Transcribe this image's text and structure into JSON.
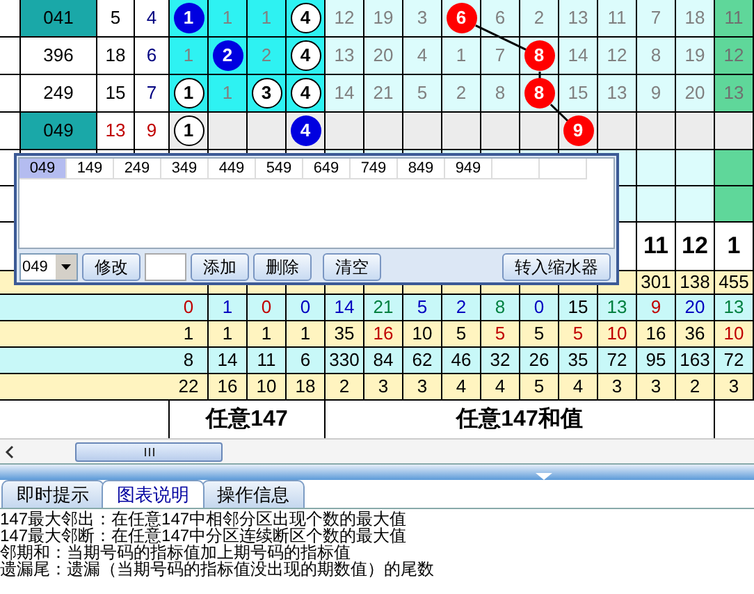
{
  "draw_rows": [
    {
      "number": "041",
      "number_highlight": true,
      "current": false,
      "sum": {
        "text": "5",
        "color": "#000000"
      },
      "span": {
        "text": "4",
        "color": "#000080"
      },
      "balls": [
        {
          "kind": "blue",
          "text": "1"
        },
        {
          "kind": "plain",
          "text": "1"
        },
        {
          "kind": "plain",
          "text": "1"
        },
        {
          "kind": "white",
          "text": "4"
        }
      ],
      "misses": [
        {
          "kind": "plain",
          "text": "12"
        },
        {
          "kind": "plain",
          "text": "19"
        },
        {
          "kind": "plain",
          "text": "3"
        },
        {
          "kind": "ball",
          "text": "6"
        },
        {
          "kind": "plain",
          "text": "6"
        },
        {
          "kind": "plain",
          "text": "2"
        },
        {
          "kind": "plain",
          "text": "13"
        },
        {
          "kind": "plain",
          "text": "11"
        },
        {
          "kind": "plain",
          "text": "7"
        },
        {
          "kind": "plain",
          "text": "18"
        }
      ],
      "tail": "11"
    },
    {
      "number": "396",
      "number_highlight": false,
      "current": false,
      "sum": {
        "text": "18",
        "color": "#000000"
      },
      "span": {
        "text": "6",
        "color": "#000080"
      },
      "balls": [
        {
          "kind": "plain",
          "text": "1"
        },
        {
          "kind": "blue",
          "text": "2"
        },
        {
          "kind": "plain",
          "text": "2"
        },
        {
          "kind": "white",
          "text": "4"
        }
      ],
      "misses": [
        {
          "kind": "plain",
          "text": "13"
        },
        {
          "kind": "plain",
          "text": "20"
        },
        {
          "kind": "plain",
          "text": "4"
        },
        {
          "kind": "plain",
          "text": "1"
        },
        {
          "kind": "plain",
          "text": "7"
        },
        {
          "kind": "ball",
          "text": "8"
        },
        {
          "kind": "plain",
          "text": "14"
        },
        {
          "kind": "plain",
          "text": "12"
        },
        {
          "kind": "plain",
          "text": "8"
        },
        {
          "kind": "plain",
          "text": "19"
        }
      ],
      "tail": "12"
    },
    {
      "number": "249",
      "number_highlight": false,
      "current": false,
      "sum": {
        "text": "15",
        "color": "#000000"
      },
      "span": {
        "text": "7",
        "color": "#000080"
      },
      "balls": [
        {
          "kind": "white",
          "text": "1"
        },
        {
          "kind": "plain",
          "text": "1"
        },
        {
          "kind": "white",
          "text": "3"
        },
        {
          "kind": "white",
          "text": "4"
        }
      ],
      "misses": [
        {
          "kind": "plain",
          "text": "14"
        },
        {
          "kind": "plain",
          "text": "21"
        },
        {
          "kind": "plain",
          "text": "5"
        },
        {
          "kind": "plain",
          "text": "2"
        },
        {
          "kind": "plain",
          "text": "8"
        },
        {
          "kind": "ball",
          "text": "8"
        },
        {
          "kind": "plain",
          "text": "15"
        },
        {
          "kind": "plain",
          "text": "13"
        },
        {
          "kind": "plain",
          "text": "9"
        },
        {
          "kind": "plain",
          "text": "20"
        }
      ],
      "tail": "13"
    },
    {
      "number": "049",
      "number_highlight": true,
      "current": true,
      "sum": {
        "text": "13",
        "color": "#c00000"
      },
      "span": {
        "text": "9",
        "color": "#c00000"
      },
      "balls": [
        {
          "kind": "white",
          "text": "1"
        },
        {
          "kind": "empty"
        },
        {
          "kind": "empty"
        },
        {
          "kind": "blue",
          "text": "4"
        }
      ],
      "misses": [
        {
          "kind": "empty"
        },
        {
          "kind": "empty"
        },
        {
          "kind": "empty"
        },
        {
          "kind": "empty"
        },
        {
          "kind": "empty"
        },
        {
          "kind": "empty"
        },
        {
          "kind": "ball",
          "text": "9"
        },
        {
          "kind": "empty"
        },
        {
          "kind": "empty"
        },
        {
          "kind": "empty"
        }
      ]
    }
  ],
  "column_numbers": [
    "11",
    "12",
    "1"
  ],
  "partial_totals": [
    "301",
    "138",
    "455"
  ],
  "stat_rows": [
    {
      "cells": [
        {
          "text": "0",
          "color": "#c00000"
        },
        {
          "text": "1",
          "color": "#0000c0"
        },
        {
          "text": "0",
          "color": "#c00000"
        },
        {
          "text": "0",
          "color": "#0000c0"
        },
        {
          "text": "14",
          "color": "#0000c0"
        },
        {
          "text": "21",
          "color": "#008040"
        },
        {
          "text": "5",
          "color": "#0000c0"
        },
        {
          "text": "2",
          "color": "#0000c0"
        },
        {
          "text": "8",
          "color": "#008040"
        },
        {
          "text": "0",
          "color": "#0000c0"
        },
        {
          "text": "15",
          "color": "#000000"
        },
        {
          "text": "13",
          "color": "#008040"
        },
        {
          "text": "9",
          "color": "#c00000"
        },
        {
          "text": "20",
          "color": "#0000c0"
        },
        {
          "text": "13",
          "color": "#008040"
        }
      ]
    },
    {
      "cells": [
        {
          "text": "1",
          "color": "#000000"
        },
        {
          "text": "1",
          "color": "#000000"
        },
        {
          "text": "1",
          "color": "#000000"
        },
        {
          "text": "1",
          "color": "#000000"
        },
        {
          "text": "35",
          "color": "#000000"
        },
        {
          "text": "16",
          "color": "#c00000"
        },
        {
          "text": "10",
          "color": "#000000"
        },
        {
          "text": "5",
          "color": "#000000"
        },
        {
          "text": "5",
          "color": "#c00000"
        },
        {
          "text": "5",
          "color": "#000000"
        },
        {
          "text": "5",
          "color": "#c00000"
        },
        {
          "text": "10",
          "color": "#c00000"
        },
        {
          "text": "16",
          "color": "#000000"
        },
        {
          "text": "36",
          "color": "#000000"
        },
        {
          "text": "10",
          "color": "#c00000"
        }
      ]
    },
    {
      "cells": [
        {
          "text": "8",
          "color": "#000000"
        },
        {
          "text": "14",
          "color": "#000000"
        },
        {
          "text": "11",
          "color": "#000000"
        },
        {
          "text": "6",
          "color": "#000000"
        },
        {
          "text": "330",
          "color": "#000000"
        },
        {
          "text": "84",
          "color": "#000000"
        },
        {
          "text": "62",
          "color": "#000000"
        },
        {
          "text": "46",
          "color": "#000000"
        },
        {
          "text": "32",
          "color": "#000000"
        },
        {
          "text": "26",
          "color": "#000000"
        },
        {
          "text": "35",
          "color": "#000000"
        },
        {
          "text": "72",
          "color": "#000000"
        },
        {
          "text": "95",
          "color": "#000000"
        },
        {
          "text": "163",
          "color": "#000000"
        },
        {
          "text": "72",
          "color": "#000000"
        }
      ]
    },
    {
      "cells": [
        {
          "text": "22",
          "color": "#000000"
        },
        {
          "text": "16",
          "color": "#000000"
        },
        {
          "text": "10",
          "color": "#000000"
        },
        {
          "text": "18",
          "color": "#000000"
        },
        {
          "text": "2",
          "color": "#000000"
        },
        {
          "text": "3",
          "color": "#000000"
        },
        {
          "text": "3",
          "color": "#000000"
        },
        {
          "text": "4",
          "color": "#000000"
        },
        {
          "text": "4",
          "color": "#000000"
        },
        {
          "text": "5",
          "color": "#000000"
        },
        {
          "text": "4",
          "color": "#000000"
        },
        {
          "text": "3",
          "color": "#000000"
        },
        {
          "text": "3",
          "color": "#000000"
        },
        {
          "text": "2",
          "color": "#000000"
        },
        {
          "text": "3",
          "color": "#000000"
        }
      ]
    }
  ],
  "footer": {
    "group_1": "任意147",
    "group_2": "任意147和值"
  },
  "popup": {
    "numbers": [
      {
        "text": "049",
        "selected": true
      },
      {
        "text": "149",
        "selected": false
      },
      {
        "text": "249",
        "selected": false
      },
      {
        "text": "349",
        "selected": false
      },
      {
        "text": "449",
        "selected": false
      },
      {
        "text": "549",
        "selected": false
      },
      {
        "text": "649",
        "selected": false
      },
      {
        "text": "749",
        "selected": false
      },
      {
        "text": "849",
        "selected": false
      },
      {
        "text": "949",
        "selected": false
      }
    ],
    "combo_value": "049",
    "buttons": [
      "修改",
      "添加",
      "删除",
      "清空"
    ],
    "convert_button": "转入缩水器"
  },
  "tabs": [
    {
      "label": "即时提示",
      "selected": false
    },
    {
      "label": "图表说明",
      "selected": true
    },
    {
      "label": "操作信息",
      "selected": false
    }
  ],
  "notes": [
    "147最大邻出：在任意147中相邻分区出现个数的最大值",
    "147最大邻断：在任意147中分区连续断区个数的最大值",
    "邻期和：当期号码的指标值加上期号码的指标值",
    "遗漏尾：遗漏（当期号码的指标值没出现的期数值）的尾数"
  ]
}
